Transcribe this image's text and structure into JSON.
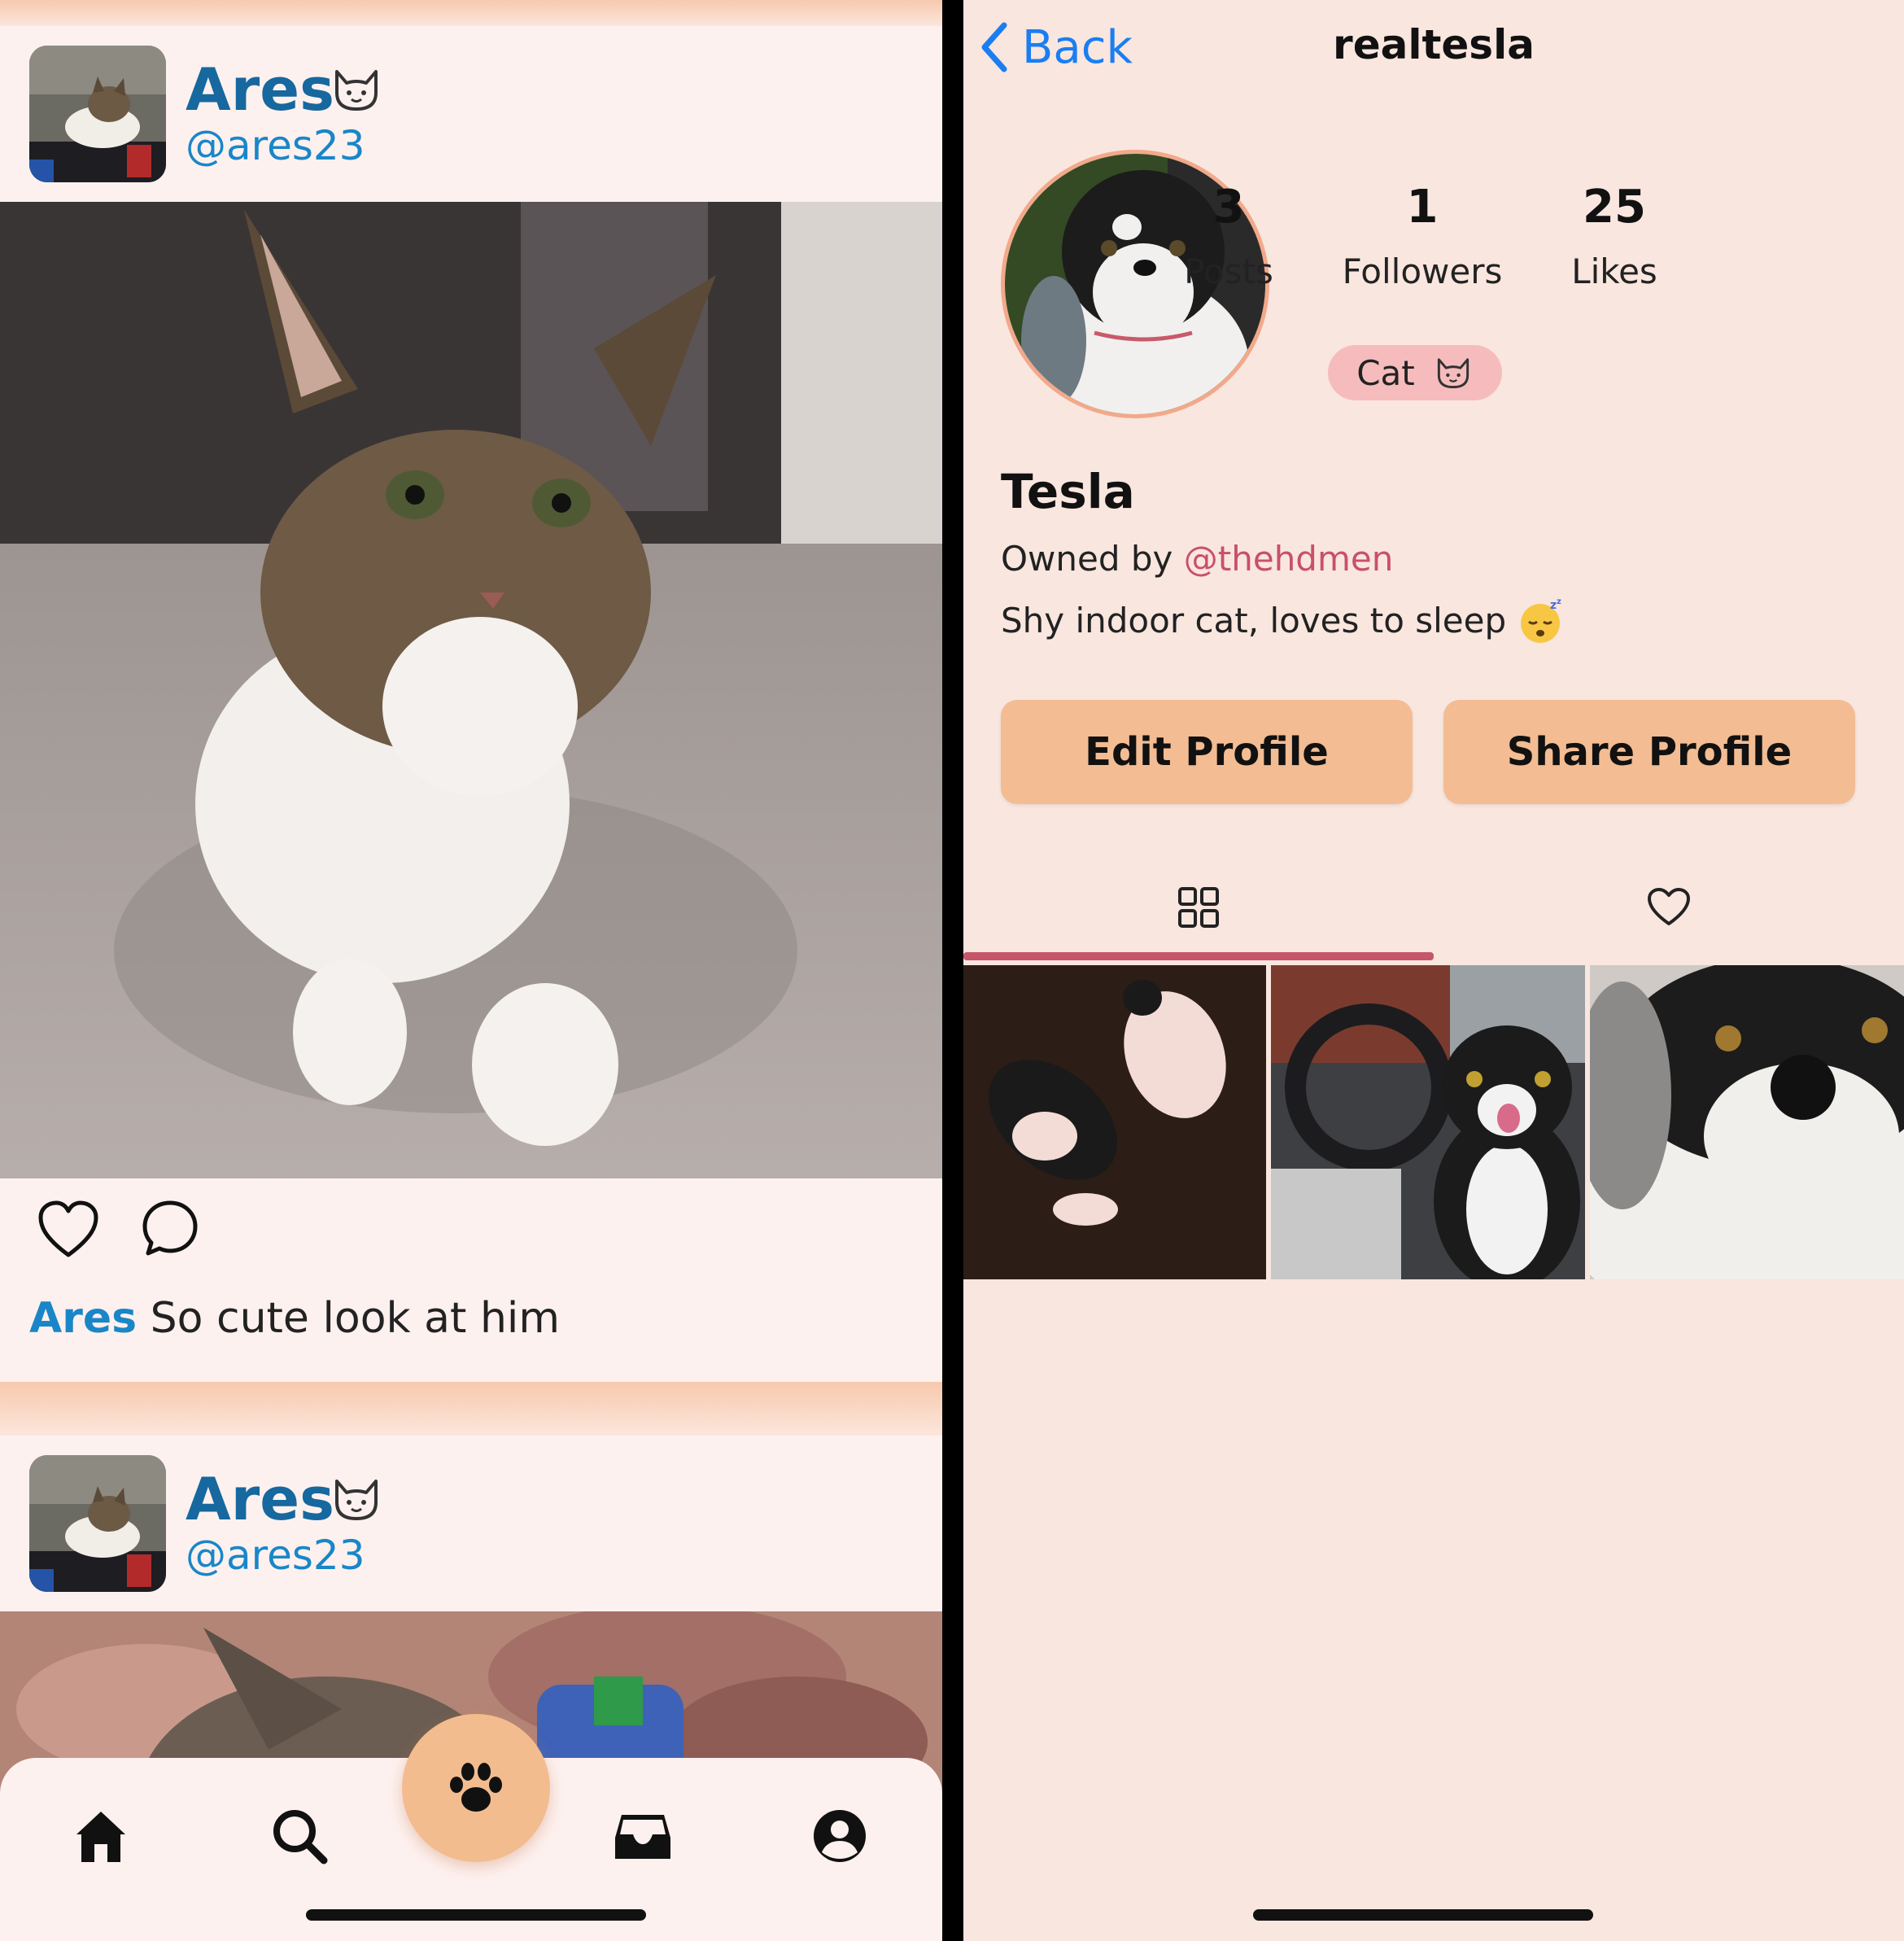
{
  "feed": {
    "posts": [
      {
        "author_name": "Ares",
        "author_handle": "@ares23",
        "caption_name": "Ares",
        "caption_text": "So cute look at him"
      },
      {
        "author_name": "Ares",
        "author_handle": "@ares23"
      }
    ],
    "tabbar": {
      "items": [
        "home-icon",
        "search-icon",
        "paw-icon",
        "inbox-icon",
        "account-icon"
      ]
    }
  },
  "profile": {
    "back_label": "Back",
    "username": "realtesla",
    "stats": [
      {
        "value": "3",
        "label": "Posts"
      },
      {
        "value": "1",
        "label": "Followers"
      },
      {
        "value": "25",
        "label": "Likes"
      }
    ],
    "species_badge": "Cat",
    "pet_name": "Tesla",
    "owned_prefix": "Owned by",
    "owner_handle": "@thehdmen",
    "bio": "Shy indoor cat, loves to sleep",
    "edit_label": "Edit Profile",
    "share_label": "Share Profile",
    "tabs": [
      "grid-icon",
      "heart-icon"
    ],
    "selected_tab": 0
  },
  "colors": {
    "accent_peach": "#f3bc92",
    "name_blue": "#16689e",
    "handle_blue": "#1a86c8",
    "owner_link": "#c8506a",
    "tab_underline": "#c6566a",
    "ios_blue": "#1a7ef2"
  }
}
